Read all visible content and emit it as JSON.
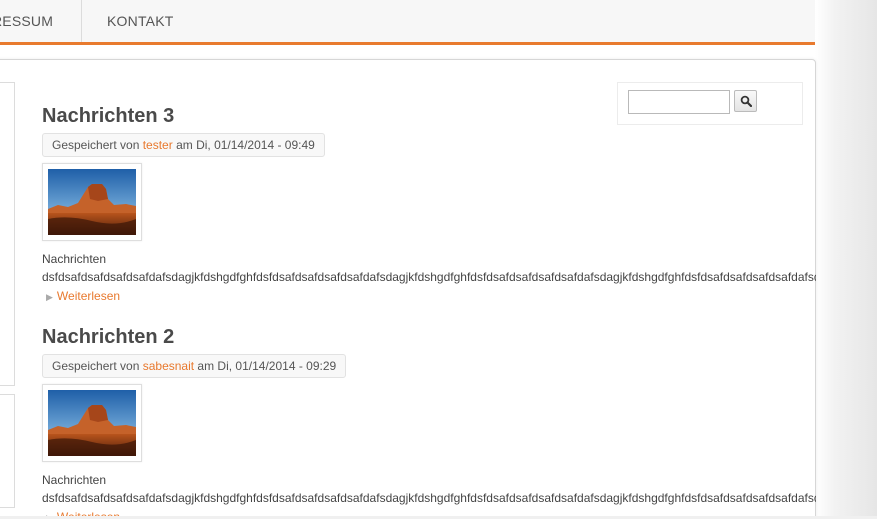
{
  "nav": {
    "items": [
      "RESSUM",
      "KONTAKT"
    ]
  },
  "colors": {
    "accent": "#e87a2e",
    "link": "#e8792e"
  },
  "search": {
    "value": "",
    "button_icon": "magnifier-icon"
  },
  "articles": [
    {
      "title": "Nachrichten 3",
      "submitted_prefix": "Gespeichert von ",
      "author": "tester",
      "submitted_suffix": " am Di, 01/14/2014 - 09:49",
      "image_icon": "desert-landscape-image",
      "body_label": "Nachrichten",
      "body_text": "dsfdsafdsafdsafdsafdafsdagjkfdshgdfghfdsfdsafdsafdsafdsafdafsdagjkfdshgdfghfdsfdsafdsafdsafdsafdafsdagjkfdshgdfghfdsfdsafdsafdsafdsafdafsdagjkfdshgdfghfdsfdsafdsafdsafd",
      "readmore": "Weiterlesen"
    },
    {
      "title": "Nachrichten 2",
      "submitted_prefix": "Gespeichert von ",
      "author": "sabesnait",
      "submitted_suffix": " am Di, 01/14/2014 - 09:29",
      "image_icon": "desert-landscape-image",
      "body_label": "Nachrichten",
      "body_text": "dsfdsafdsafdsafdsafdafsdagjkfdshgdfghfdsfdsafdsafdsafdsafdafsdagjkfdshgdfghfdsfdsafdsafdsafdsafdafsdagjkfdshgdfghfdsfdsafdsafdsafdsafdafsdagjkfdshgdfghfdsfdsafdsafdsafd",
      "readmore": "Weiterlesen"
    }
  ]
}
